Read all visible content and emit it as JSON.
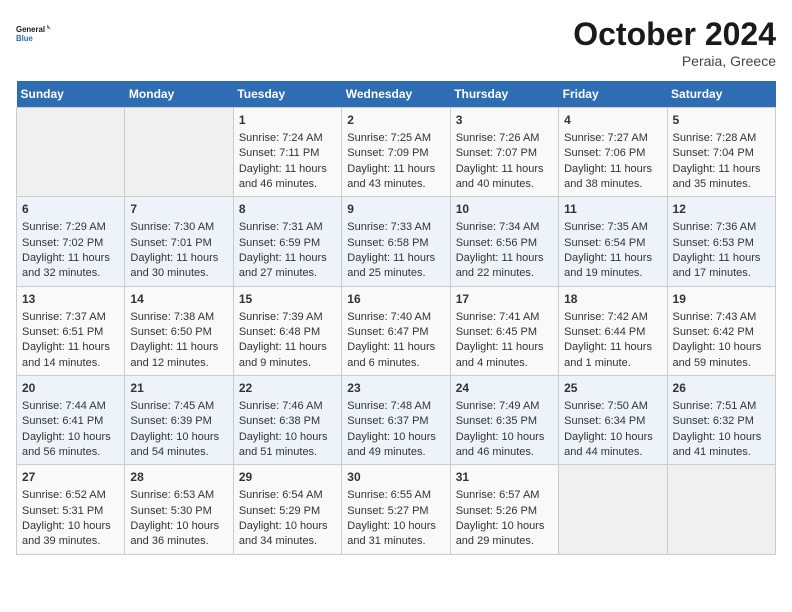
{
  "logo": {
    "line1": "General",
    "line2": "Blue"
  },
  "title": "October 2024",
  "location": "Peraia, Greece",
  "days_of_week": [
    "Sunday",
    "Monday",
    "Tuesday",
    "Wednesday",
    "Thursday",
    "Friday",
    "Saturday"
  ],
  "weeks": [
    [
      {
        "day": "",
        "data": ""
      },
      {
        "day": "",
        "data": ""
      },
      {
        "day": "1",
        "sunrise": "Sunrise: 7:24 AM",
        "sunset": "Sunset: 7:11 PM",
        "daylight": "Daylight: 11 hours and 46 minutes."
      },
      {
        "day": "2",
        "sunrise": "Sunrise: 7:25 AM",
        "sunset": "Sunset: 7:09 PM",
        "daylight": "Daylight: 11 hours and 43 minutes."
      },
      {
        "day": "3",
        "sunrise": "Sunrise: 7:26 AM",
        "sunset": "Sunset: 7:07 PM",
        "daylight": "Daylight: 11 hours and 40 minutes."
      },
      {
        "day": "4",
        "sunrise": "Sunrise: 7:27 AM",
        "sunset": "Sunset: 7:06 PM",
        "daylight": "Daylight: 11 hours and 38 minutes."
      },
      {
        "day": "5",
        "sunrise": "Sunrise: 7:28 AM",
        "sunset": "Sunset: 7:04 PM",
        "daylight": "Daylight: 11 hours and 35 minutes."
      }
    ],
    [
      {
        "day": "6",
        "sunrise": "Sunrise: 7:29 AM",
        "sunset": "Sunset: 7:02 PM",
        "daylight": "Daylight: 11 hours and 32 minutes."
      },
      {
        "day": "7",
        "sunrise": "Sunrise: 7:30 AM",
        "sunset": "Sunset: 7:01 PM",
        "daylight": "Daylight: 11 hours and 30 minutes."
      },
      {
        "day": "8",
        "sunrise": "Sunrise: 7:31 AM",
        "sunset": "Sunset: 6:59 PM",
        "daylight": "Daylight: 11 hours and 27 minutes."
      },
      {
        "day": "9",
        "sunrise": "Sunrise: 7:33 AM",
        "sunset": "Sunset: 6:58 PM",
        "daylight": "Daylight: 11 hours and 25 minutes."
      },
      {
        "day": "10",
        "sunrise": "Sunrise: 7:34 AM",
        "sunset": "Sunset: 6:56 PM",
        "daylight": "Daylight: 11 hours and 22 minutes."
      },
      {
        "day": "11",
        "sunrise": "Sunrise: 7:35 AM",
        "sunset": "Sunset: 6:54 PM",
        "daylight": "Daylight: 11 hours and 19 minutes."
      },
      {
        "day": "12",
        "sunrise": "Sunrise: 7:36 AM",
        "sunset": "Sunset: 6:53 PM",
        "daylight": "Daylight: 11 hours and 17 minutes."
      }
    ],
    [
      {
        "day": "13",
        "sunrise": "Sunrise: 7:37 AM",
        "sunset": "Sunset: 6:51 PM",
        "daylight": "Daylight: 11 hours and 14 minutes."
      },
      {
        "day": "14",
        "sunrise": "Sunrise: 7:38 AM",
        "sunset": "Sunset: 6:50 PM",
        "daylight": "Daylight: 11 hours and 12 minutes."
      },
      {
        "day": "15",
        "sunrise": "Sunrise: 7:39 AM",
        "sunset": "Sunset: 6:48 PM",
        "daylight": "Daylight: 11 hours and 9 minutes."
      },
      {
        "day": "16",
        "sunrise": "Sunrise: 7:40 AM",
        "sunset": "Sunset: 6:47 PM",
        "daylight": "Daylight: 11 hours and 6 minutes."
      },
      {
        "day": "17",
        "sunrise": "Sunrise: 7:41 AM",
        "sunset": "Sunset: 6:45 PM",
        "daylight": "Daylight: 11 hours and 4 minutes."
      },
      {
        "day": "18",
        "sunrise": "Sunrise: 7:42 AM",
        "sunset": "Sunset: 6:44 PM",
        "daylight": "Daylight: 11 hours and 1 minute."
      },
      {
        "day": "19",
        "sunrise": "Sunrise: 7:43 AM",
        "sunset": "Sunset: 6:42 PM",
        "daylight": "Daylight: 10 hours and 59 minutes."
      }
    ],
    [
      {
        "day": "20",
        "sunrise": "Sunrise: 7:44 AM",
        "sunset": "Sunset: 6:41 PM",
        "daylight": "Daylight: 10 hours and 56 minutes."
      },
      {
        "day": "21",
        "sunrise": "Sunrise: 7:45 AM",
        "sunset": "Sunset: 6:39 PM",
        "daylight": "Daylight: 10 hours and 54 minutes."
      },
      {
        "day": "22",
        "sunrise": "Sunrise: 7:46 AM",
        "sunset": "Sunset: 6:38 PM",
        "daylight": "Daylight: 10 hours and 51 minutes."
      },
      {
        "day": "23",
        "sunrise": "Sunrise: 7:48 AM",
        "sunset": "Sunset: 6:37 PM",
        "daylight": "Daylight: 10 hours and 49 minutes."
      },
      {
        "day": "24",
        "sunrise": "Sunrise: 7:49 AM",
        "sunset": "Sunset: 6:35 PM",
        "daylight": "Daylight: 10 hours and 46 minutes."
      },
      {
        "day": "25",
        "sunrise": "Sunrise: 7:50 AM",
        "sunset": "Sunset: 6:34 PM",
        "daylight": "Daylight: 10 hours and 44 minutes."
      },
      {
        "day": "26",
        "sunrise": "Sunrise: 7:51 AM",
        "sunset": "Sunset: 6:32 PM",
        "daylight": "Daylight: 10 hours and 41 minutes."
      }
    ],
    [
      {
        "day": "27",
        "sunrise": "Sunrise: 6:52 AM",
        "sunset": "Sunset: 5:31 PM",
        "daylight": "Daylight: 10 hours and 39 minutes."
      },
      {
        "day": "28",
        "sunrise": "Sunrise: 6:53 AM",
        "sunset": "Sunset: 5:30 PM",
        "daylight": "Daylight: 10 hours and 36 minutes."
      },
      {
        "day": "29",
        "sunrise": "Sunrise: 6:54 AM",
        "sunset": "Sunset: 5:29 PM",
        "daylight": "Daylight: 10 hours and 34 minutes."
      },
      {
        "day": "30",
        "sunrise": "Sunrise: 6:55 AM",
        "sunset": "Sunset: 5:27 PM",
        "daylight": "Daylight: 10 hours and 31 minutes."
      },
      {
        "day": "31",
        "sunrise": "Sunrise: 6:57 AM",
        "sunset": "Sunset: 5:26 PM",
        "daylight": "Daylight: 10 hours and 29 minutes."
      },
      {
        "day": "",
        "data": ""
      },
      {
        "day": "",
        "data": ""
      }
    ]
  ]
}
